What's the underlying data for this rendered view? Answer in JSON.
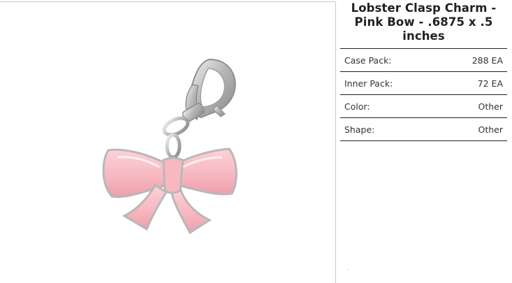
{
  "product": {
    "title_line1": "Lobster Clasp Charm -",
    "title_line2": "Pink Bow - .6875 x .5",
    "title_line3": "inches",
    "image_icon": "pink-bow-charm-photo"
  },
  "specs": [
    {
      "label": "Case Pack:",
      "value": "288 EA"
    },
    {
      "label": "Inner Pack:",
      "value": "72 EA"
    },
    {
      "label": "Color:",
      "value": "Other"
    },
    {
      "label": "Shape:",
      "value": "Other"
    }
  ],
  "colors": {
    "bow_pink": "#f7b8c0",
    "silver": "#c9c9c9",
    "divider": "#222222"
  }
}
